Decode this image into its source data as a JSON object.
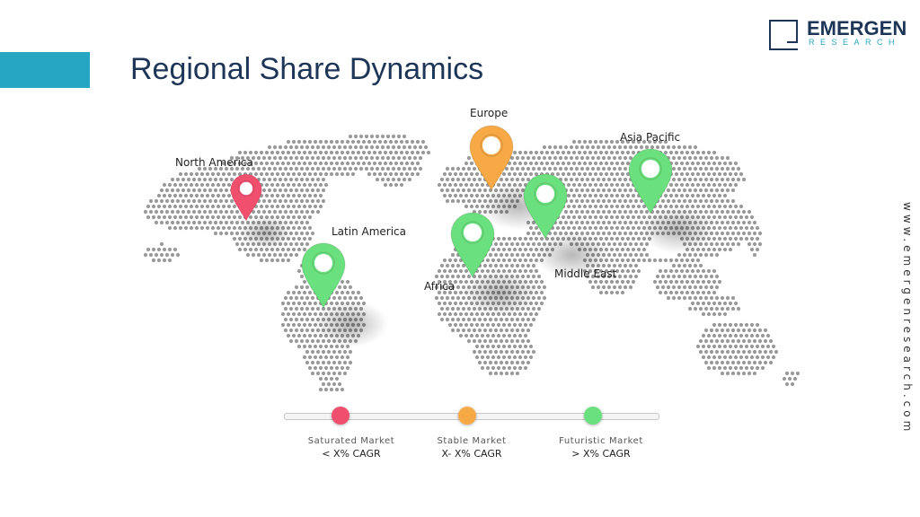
{
  "slide": {
    "title": "Regional Share Dynamics",
    "website": "www.emergenresearch.com"
  },
  "logo": {
    "main": "EMERGEN",
    "sub": "RESEARCH"
  },
  "colors": {
    "accent_bar": "#26a6c2",
    "title": "#1d3557",
    "saturated": "#f0506e",
    "stable": "#f7a945",
    "futuristic": "#6be07e",
    "map_dots": "#9a9a9a"
  },
  "regions": [
    {
      "id": "north-america",
      "label": "North America",
      "status": "saturated"
    },
    {
      "id": "europe",
      "label": "Europe",
      "status": "stable"
    },
    {
      "id": "asia-pacific",
      "label": "Asia Pacific",
      "status": "futuristic"
    },
    {
      "id": "latin-america",
      "label": "Latin America",
      "status": "futuristic"
    },
    {
      "id": "africa",
      "label": "Africa",
      "status": "futuristic"
    },
    {
      "id": "middle-east",
      "label": "Middle East",
      "status": "futuristic"
    }
  ],
  "legend": [
    {
      "id": "saturated",
      "title": "Saturated Market",
      "sub": "< X% CAGR"
    },
    {
      "id": "stable",
      "title": "Stable Market",
      "sub": "X- X% CAGR"
    },
    {
      "id": "futuristic",
      "title": "Futuristic Market",
      "sub": "> X% CAGR"
    }
  ]
}
